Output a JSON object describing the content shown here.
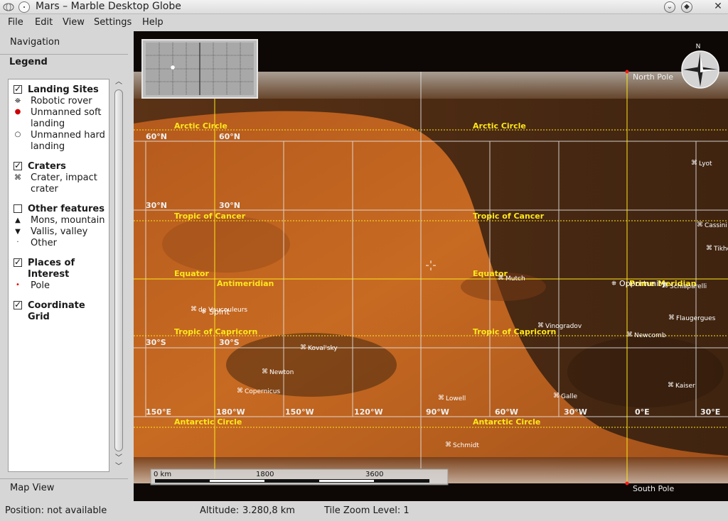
{
  "window": {
    "title": "Mars – Marble Desktop Globe"
  },
  "menu": [
    "File",
    "Edit",
    "View",
    "Settings",
    "Help"
  ],
  "panel": {
    "navigation_tab": "Navigation",
    "legend_tab": "Legend",
    "mapview_tab": "Map View",
    "sections": [
      {
        "title": "Landing Sites",
        "checked": true,
        "items": [
          {
            "icon": "rover-icon",
            "label": "Robotic rover"
          },
          {
            "icon": "soft-landing-icon",
            "label": "Unmanned soft landing"
          },
          {
            "icon": "hard-landing-icon",
            "label": "Unmanned hard landing"
          }
        ]
      },
      {
        "title": "Craters",
        "checked": true,
        "items": [
          {
            "icon": "crater-icon",
            "label": "Crater, impact crater"
          }
        ]
      },
      {
        "title": "Other features",
        "checked": false,
        "items": [
          {
            "icon": "mountain-icon",
            "label": "Mons, mountain"
          },
          {
            "icon": "valley-icon",
            "label": "Vallis, valley"
          },
          {
            "icon": "other-icon",
            "label": "Other"
          }
        ]
      },
      {
        "title": "Places of Interest",
        "checked": true,
        "items": [
          {
            "icon": "pole-icon",
            "label": "Pole"
          }
        ]
      },
      {
        "title": "Coordinate Grid",
        "checked": true,
        "items": []
      }
    ]
  },
  "map": {
    "circles": [
      {
        "label": "Arctic Circle"
      },
      {
        "label": "Tropic of Cancer"
      },
      {
        "label": "Equator"
      },
      {
        "label": "Tropic of Capricorn"
      },
      {
        "label": "Antarctic Circle"
      }
    ],
    "antimeridian_label": "Antimeridian",
    "prime_meridian_label": "Prime Meridian",
    "lat_labels": [
      "60°N",
      "30°N",
      "30°S"
    ],
    "lon_labels": [
      "150°W",
      "120°W",
      "90°W",
      "60°W",
      "30°W",
      "0°E",
      "30°E",
      "180°W",
      "150°E"
    ],
    "pole_labels": {
      "north": "North Pole",
      "south": "South Pole"
    },
    "compass_label": "N",
    "places": [
      {
        "name": "Lyot",
        "type": "crater"
      },
      {
        "name": "Cassini",
        "type": "crater"
      },
      {
        "name": "Tikhov",
        "type": "crater"
      },
      {
        "name": "Mutch",
        "type": "crater"
      },
      {
        "name": "Opportunity",
        "type": "rover"
      },
      {
        "name": "Schiaparelli",
        "type": "crater"
      },
      {
        "name": "de Vaucouleurs",
        "type": "crater"
      },
      {
        "name": "Spirit",
        "type": "rover"
      },
      {
        "name": "Flaugergues",
        "type": "crater"
      },
      {
        "name": "Vinogradov",
        "type": "crater"
      },
      {
        "name": "Newcomb",
        "type": "crater"
      },
      {
        "name": "Koval'sky",
        "type": "crater"
      },
      {
        "name": "Newton",
        "type": "crater"
      },
      {
        "name": "Kaiser",
        "type": "crater"
      },
      {
        "name": "Copernicus",
        "type": "crater"
      },
      {
        "name": "Lowell",
        "type": "crater"
      },
      {
        "name": "Galle",
        "type": "crater"
      },
      {
        "name": "Schmidt",
        "type": "crater"
      }
    ],
    "scale": {
      "labels": [
        "0 km",
        "1800",
        "3600"
      ]
    }
  },
  "status": {
    "position": "Position: not available",
    "altitude_label": "Altitude:",
    "altitude_value": "3.280,8 km",
    "zoom": "Tile Zoom Level: 1"
  },
  "colors": {
    "grid_yellow": "#ffe81a",
    "grid_white": "#e8e8e8",
    "mars_bright": "#c2631e",
    "mars_night": "#4a2a12",
    "pole_red": "#ff1a1a"
  }
}
